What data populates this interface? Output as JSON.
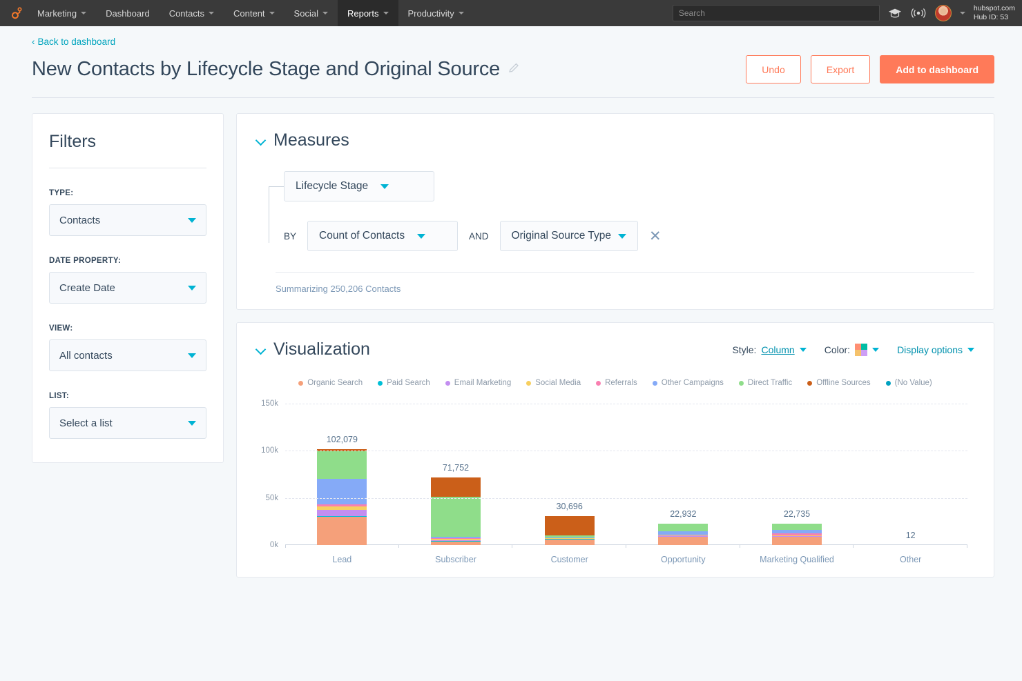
{
  "topnav": {
    "logo_icon": "hubspot-sprocket-icon",
    "items": [
      {
        "label": "Marketing",
        "caret": true,
        "active": false
      },
      {
        "label": "Dashboard",
        "caret": false,
        "active": false
      },
      {
        "label": "Contacts",
        "caret": true,
        "active": false
      },
      {
        "label": "Content",
        "caret": true,
        "active": false
      },
      {
        "label": "Social",
        "caret": true,
        "active": false
      },
      {
        "label": "Reports",
        "caret": true,
        "active": true
      },
      {
        "label": "Productivity",
        "caret": true,
        "active": false
      }
    ],
    "search_placeholder": "Search",
    "search_value": "",
    "academy_icon": "graduation-cap-icon",
    "notifications_icon": "broadcast-icon",
    "account_name": "hubspot.com",
    "hub_id": "Hub ID: 53"
  },
  "header": {
    "back_link": "Back to dashboard",
    "title": "New Contacts by Lifecycle Stage and Original Source",
    "edit_icon": "pencil-icon",
    "undo_label": "Undo",
    "export_label": "Export",
    "add_label": "Add to dashboard"
  },
  "filters": {
    "title": "Filters",
    "fields": [
      {
        "label": "TYPE:",
        "value": "Contacts"
      },
      {
        "label": "DATE PROPERTY:",
        "value": "Create Date"
      },
      {
        "label": "VIEW:",
        "value": "All contacts"
      },
      {
        "label": "LIST:",
        "value": "Select a list"
      }
    ]
  },
  "measures": {
    "title": "Measures",
    "primary": "Lifecycle Stage",
    "by_label": "BY",
    "by_value": "Count of Contacts",
    "and_label": "AND",
    "and_value": "Original Source Type",
    "remove_icon": "close-icon",
    "summarizing": "Summarizing 250,206 Contacts"
  },
  "visualization": {
    "title": "Visualization",
    "style_label": "Style:",
    "style_value": "Column",
    "color_label": "Color:",
    "color_swatch": [
      "#ff8f73",
      "#00bda5",
      "#f5c26b",
      "#cd9ef5"
    ],
    "display_options_label": "Display options"
  },
  "chart_data": {
    "type": "bar",
    "subtype": "stacked-column",
    "title": "New Contacts by Lifecycle Stage and Original Source",
    "xlabel": "",
    "ylabel": "",
    "ylim": [
      0,
      150000
    ],
    "yticks": [
      0,
      50000,
      100000,
      150000
    ],
    "ytick_labels": [
      "0k",
      "50k",
      "100k",
      "150k"
    ],
    "grid": true,
    "legend_position": "top",
    "categories": [
      "Lead",
      "Subscriber",
      "Customer",
      "Opportunity",
      "Marketing Qualified",
      "Other"
    ],
    "totals": [
      102079,
      71752,
      30696,
      22932,
      22735,
      12
    ],
    "total_labels": [
      "102,079",
      "71,752",
      "30,696",
      "22,932",
      "22,735",
      "12"
    ],
    "series": [
      {
        "name": "Organic Search",
        "color": "#f5a07a",
        "values": [
          30000,
          4000,
          6200,
          8600,
          8900,
          4
        ]
      },
      {
        "name": "Paid Search",
        "color": "#00bfd6",
        "values": [
          600,
          300,
          250,
          260,
          250,
          1
        ]
      },
      {
        "name": "Email Marketing",
        "color": "#c38ef0",
        "values": [
          6500,
          500,
          300,
          1200,
          700,
          1
        ]
      },
      {
        "name": "Social Media",
        "color": "#f7cf5f",
        "values": [
          3600,
          1900,
          450,
          600,
          500,
          1
        ]
      },
      {
        "name": "Referrals",
        "color": "#f97fb0",
        "values": [
          2400,
          300,
          250,
          300,
          1800,
          1
        ]
      },
      {
        "name": "Other Campaigns",
        "color": "#85aaf7",
        "values": [
          27500,
          1700,
          400,
          3900,
          3700,
          2
        ]
      },
      {
        "name": "Direct Traffic",
        "color": "#8fdd8a",
        "values": [
          29000,
          42500,
          2200,
          8000,
          6800,
          1
        ]
      },
      {
        "name": "Offline Sources",
        "color": "#cb5f19",
        "values": [
          2400,
          20550,
          20646,
          70,
          80,
          1
        ]
      },
      {
        "name": "(No Value)",
        "color": "#00a1c0",
        "values": [
          79,
          2,
          0,
          2,
          5,
          0
        ]
      }
    ]
  }
}
